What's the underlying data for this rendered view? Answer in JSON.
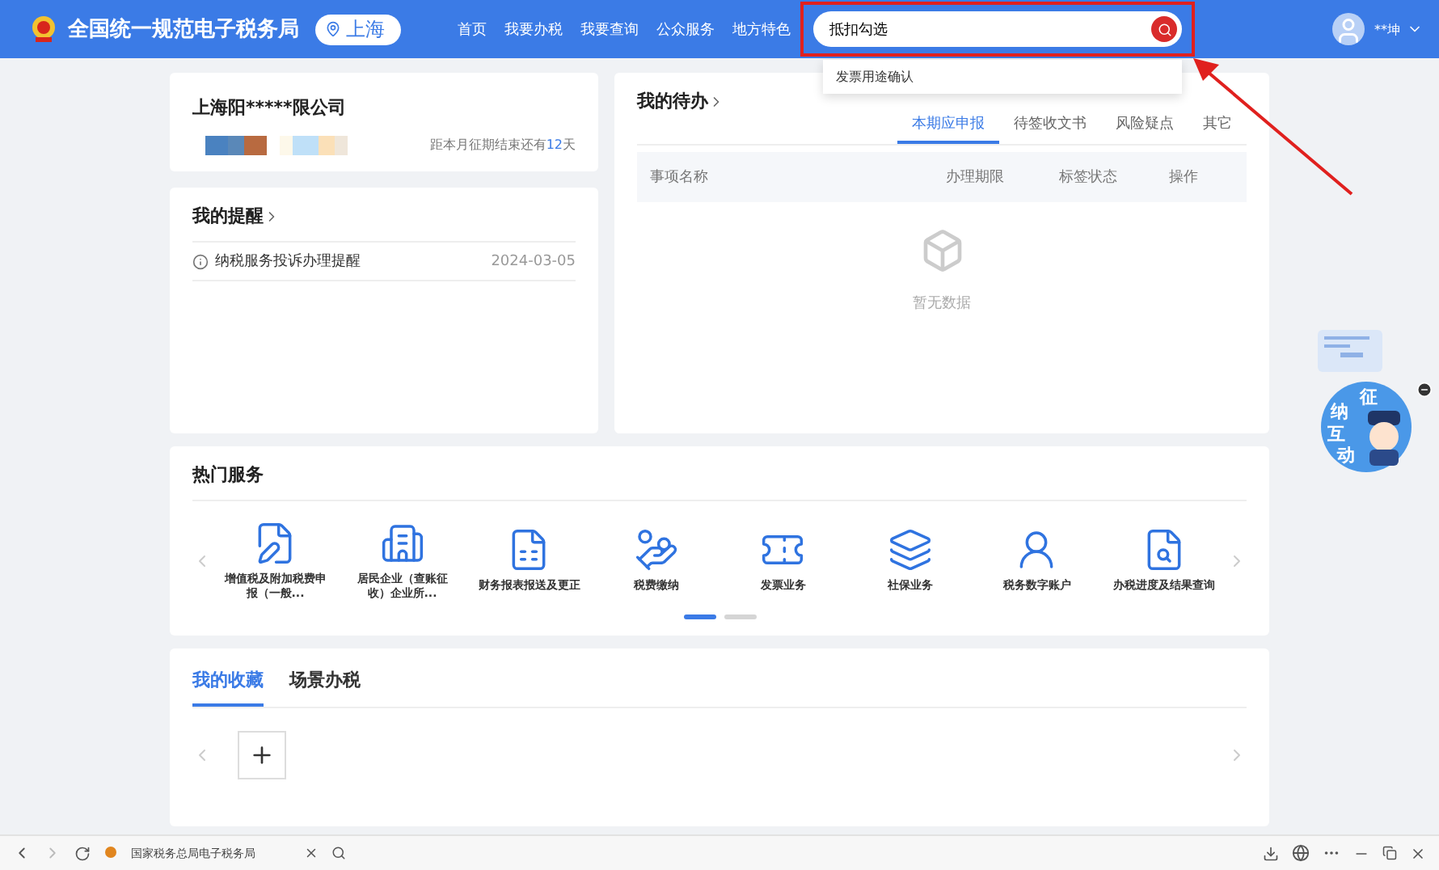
{
  "header": {
    "site_title": "全国统一规范电子税务局",
    "region": "上海",
    "nav": [
      "首页",
      "我要办税",
      "我要查询",
      "公众服务",
      "地方特色"
    ],
    "search": {
      "value": "抵扣勾选"
    },
    "suggestions": [
      "发票用途确认"
    ],
    "user": "**坤"
  },
  "company": {
    "name": "上海阳*****限公司",
    "deadline": "距本月征期结束还有**12**天"
  },
  "reminders": {
    "title": "我的提醒",
    "items": [
      {
        "text": "纳税服务投诉办理提醒",
        "date": "2024-03-05"
      }
    ]
  },
  "todo": {
    "title": "我的待办",
    "tabs": [
      {
        "label": "本期应申报",
        "selected": true
      },
      {
        "label": "待签收文书",
        "selected": false
      },
      {
        "label": "风险疑点",
        "selected": false
      },
      {
        "label": "其它",
        "selected": false
      }
    ],
    "columns": [
      "事项名称",
      "办理期限",
      "标签状态",
      "操作"
    ],
    "empty": "暂无数据"
  },
  "hot_services": {
    "title": "热门服务",
    "items": [
      {
        "kind": "doc-pen",
        "label": "增值税及附加税费申报（一般..."
      },
      {
        "kind": "building",
        "label": "居民企业（查账征收）企业所..."
      },
      {
        "kind": "report",
        "label": "财务报表报送及更正"
      },
      {
        "kind": "hand-coin",
        "label": "税费缴纳"
      },
      {
        "kind": "ticket",
        "label": "发票业务"
      },
      {
        "kind": "layers",
        "label": "社保业务"
      },
      {
        "kind": "person",
        "label": "税务数字账户"
      },
      {
        "kind": "doc-search",
        "label": "办税进度及结果查询"
      }
    ],
    "pages": [
      {
        "selected": true
      },
      {
        "selected": false
      }
    ]
  },
  "favorites": {
    "tabs": [
      {
        "label": "我的收藏",
        "selected": true
      },
      {
        "label": "场景办税",
        "selected": false
      }
    ]
  },
  "mascot": {
    "chars": [
      "征",
      "纳",
      "互",
      "动"
    ]
  },
  "browser": {
    "tab_title": "国家税务总局电子税务局"
  }
}
